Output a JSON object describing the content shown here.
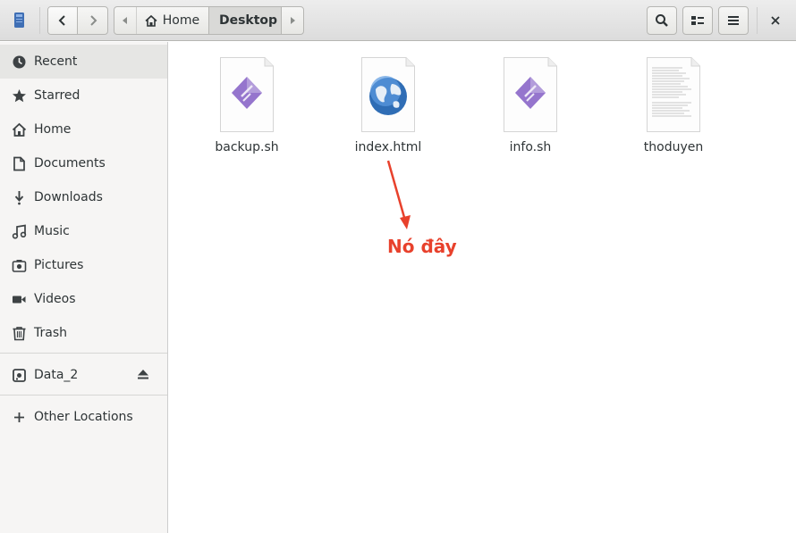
{
  "headerbar": {
    "path": [
      {
        "label": "Home",
        "icon": "home-icon"
      },
      {
        "label": "Desktop",
        "current": true
      }
    ],
    "buttons": [
      "back-icon",
      "forward-icon",
      "search-icon",
      "view-icon",
      "menu-icon",
      "close-icon"
    ]
  },
  "sidebar": {
    "items": [
      {
        "label": "Recent",
        "icon": "recent-icon",
        "active": true
      },
      {
        "label": "Starred",
        "icon": "star-icon"
      },
      {
        "label": "Home",
        "icon": "home-icon"
      },
      {
        "label": "Documents",
        "icon": "document-icon"
      },
      {
        "label": "Downloads",
        "icon": "download-icon"
      },
      {
        "label": "Music",
        "icon": "music-icon"
      },
      {
        "label": "Pictures",
        "icon": "camera-icon"
      },
      {
        "label": "Videos",
        "icon": "video-icon"
      },
      {
        "label": "Trash",
        "icon": "trash-icon"
      }
    ],
    "devices": [
      {
        "label": "Data_2",
        "icon": "drive-icon"
      }
    ],
    "other": {
      "label": "Other Locations",
      "icon": "plus-icon"
    }
  },
  "files": [
    {
      "name": "backup.sh",
      "type": "script"
    },
    {
      "name": "index.html",
      "type": "html"
    },
    {
      "name": "info.sh",
      "type": "script"
    },
    {
      "name": "thoduyen",
      "type": "text"
    }
  ],
  "annotation": {
    "text": "Nó đây",
    "color": "#e8412c"
  }
}
